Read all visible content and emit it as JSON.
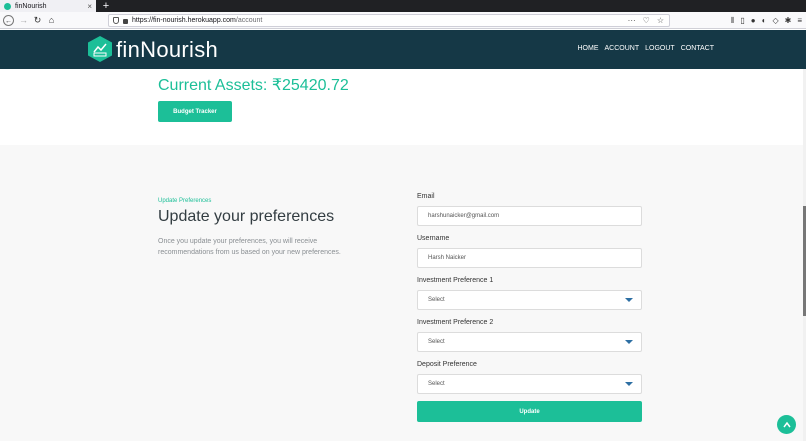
{
  "browser": {
    "tab_title": "finNourish",
    "tab_close": "×",
    "new_tab": "+",
    "url_host": "https://fin-nourish.herokuapp.com",
    "url_path": "/account"
  },
  "site": {
    "logo_text": "finNourish",
    "nav": [
      "HOME",
      "ACCOUNT",
      "LOGOUT",
      "CONTACT"
    ]
  },
  "assets": {
    "title": "Current Assets: ₹25420.72",
    "tracker_button": "Budget Tracker"
  },
  "preferences": {
    "kicker": "Update Preferences",
    "heading": "Update your preferences",
    "description": "Once you update your preferences, you will receive recommendations from us based on your new preferences.",
    "email_label": "Email",
    "email_value": "harshunaicker@gmail.com",
    "username_label": "Username",
    "username_value": "Harsh Naicker",
    "inv1_label": "Investment Preference 1",
    "inv1_value": "Select",
    "inv2_label": "Investment Preference 2",
    "inv2_value": "Select",
    "deposit_label": "Deposit Preference",
    "deposit_value": "Select",
    "update_button": "Update"
  },
  "icons": {
    "logo": "hexagon-logo-icon",
    "to_top": "chevron-up-icon"
  },
  "colors": {
    "brand_teal": "#1cbf98",
    "header_navy": "#153846"
  }
}
